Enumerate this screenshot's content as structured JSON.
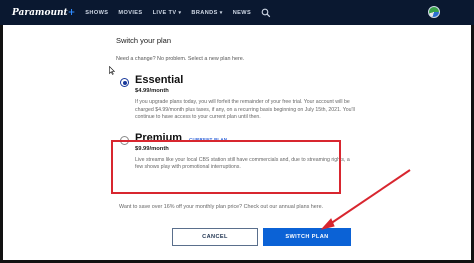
{
  "nav": {
    "logo": "Paramount",
    "logo_plus": "+",
    "items": [
      "SHOWS",
      "MOVIES",
      "LIVE TV",
      "BRANDS",
      "NEWS"
    ]
  },
  "page": {
    "title": "Switch your plan",
    "subtitle": "Need a change? No problem. Select a new plan here."
  },
  "plans": {
    "essential": {
      "name": "Essential",
      "price": "$4.99/month",
      "description": "If you upgrade plans today, you will forfeit the remainder of your free trial. Your account will be charged $4.99/month plus taxes, if any, on a recurring basis beginning on July 15th, 2021. You'll continue to have access to your current plan until then.",
      "selected": true
    },
    "premium": {
      "name": "Premium",
      "badge": "CURRENT PLAN",
      "price": "$9.99/month",
      "description": "Live streams like your local CBS station still have commercials and, due to streaming rights, a few shows play with promotional interruptions.",
      "selected": false
    }
  },
  "annual_note": "Want to save over 16% off your monthly plan price? Check out our annual plans here.",
  "buttons": {
    "cancel": "CANCEL",
    "switch": "SWITCH PLAN"
  },
  "colors": {
    "nav_bg": "#0a1830",
    "accent": "#0b62d6",
    "highlight": "#d8262f"
  },
  "icons": {
    "search": "search-icon",
    "avatar": "avatar",
    "pointer": "arrow-cursor-icon",
    "annotation": "red-arrow-annotation"
  }
}
